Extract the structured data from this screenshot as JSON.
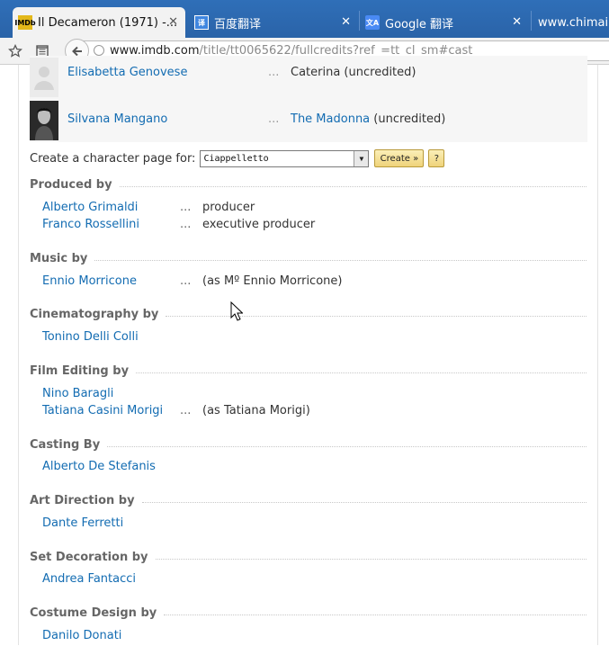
{
  "browser": {
    "tabs": [
      {
        "title": "Il Decameron (1971) -...",
        "favicon": "IMDb",
        "active": true
      },
      {
        "title": "百度翻译",
        "favicon": "译",
        "active": false
      },
      {
        "title": "Google 翻译",
        "favicon": "文A",
        "active": false
      },
      {
        "title": "www.chimai.c",
        "favicon": "",
        "active": false
      }
    ],
    "close_glyph": "✕",
    "address": {
      "host": "www.imdb.com",
      "path": "/title/tt0065622/fullcredits?ref_=tt_cl_sm#cast"
    }
  },
  "cast": [
    {
      "name": "Elisabetta Genovese",
      "dots": "...",
      "character": "",
      "note": "Caterina (uncredited)",
      "photo": "placeholder"
    },
    {
      "name": "Silvana Mangano",
      "dots": "...",
      "character": "The Madonna",
      "note": " (uncredited)",
      "photo": "portrait"
    }
  ],
  "character_page": {
    "label": "Create a character page for:",
    "selected": "Ciappelletto",
    "create_label": "Create »",
    "help_label": "?"
  },
  "sections": [
    {
      "title": "Produced by",
      "crew": [
        {
          "name": "Alberto Grimaldi",
          "dots": "...",
          "credit": "producer"
        },
        {
          "name": "Franco Rossellini",
          "dots": "...",
          "credit": "executive producer"
        }
      ]
    },
    {
      "title": "Music by",
      "crew": [
        {
          "name": "Ennio Morricone",
          "dots": "...",
          "credit": "(as Mº Ennio Morricone)"
        }
      ]
    },
    {
      "title": "Cinematography by",
      "crew": [
        {
          "name": "Tonino Delli Colli",
          "dots": "",
          "credit": ""
        }
      ]
    },
    {
      "title": "Film Editing by",
      "crew": [
        {
          "name": "Nino Baragli",
          "dots": "",
          "credit": ""
        },
        {
          "name": "Tatiana Casini Morigi",
          "dots": "...",
          "credit": "(as Tatiana Morigi)"
        }
      ]
    },
    {
      "title": "Casting By",
      "crew": [
        {
          "name": "Alberto De Stefanis",
          "dots": "",
          "credit": ""
        }
      ]
    },
    {
      "title": "Art Direction by",
      "crew": [
        {
          "name": "Dante Ferretti",
          "dots": "",
          "credit": ""
        }
      ]
    },
    {
      "title": "Set Decoration by",
      "crew": [
        {
          "name": "Andrea Fantacci",
          "dots": "",
          "credit": ""
        }
      ]
    },
    {
      "title": "Costume Design by",
      "crew": [
        {
          "name": "Danilo Donati",
          "dots": "",
          "credit": ""
        }
      ]
    }
  ],
  "colors": {
    "link": "#136cb2",
    "tabbar": "#2f6fb8",
    "section_title": "#666666"
  }
}
